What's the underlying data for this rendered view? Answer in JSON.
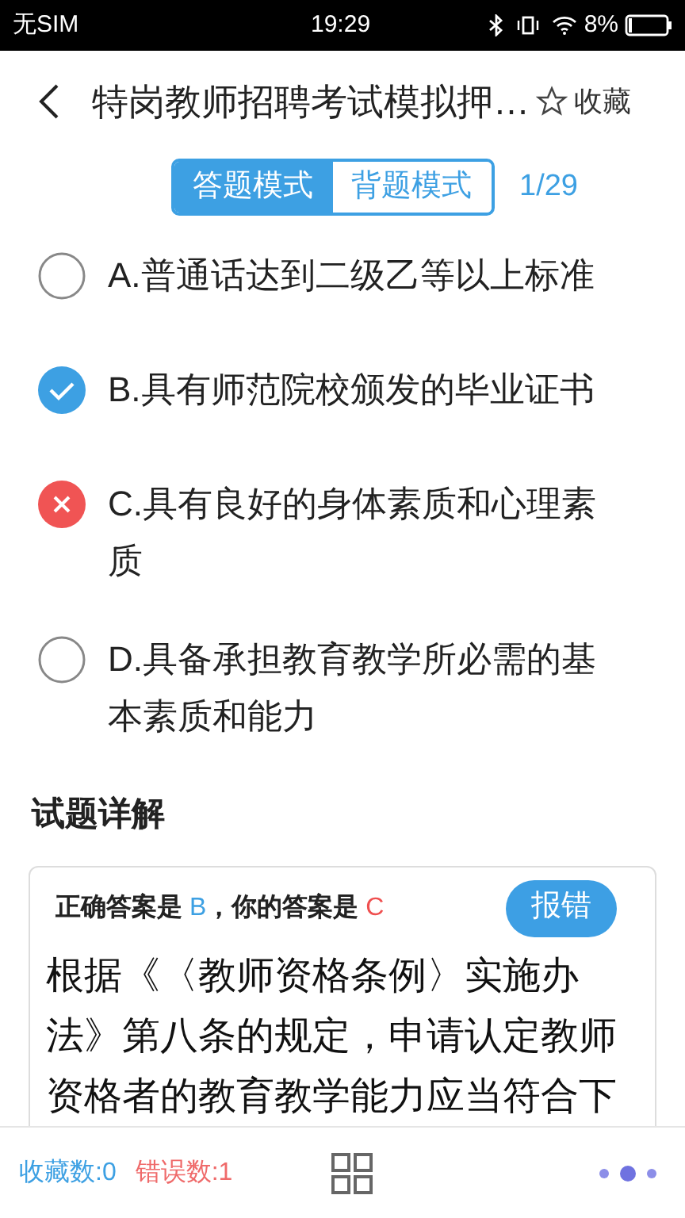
{
  "status_bar": {
    "carrier": "无SIM",
    "time": "19:29",
    "battery": "8%"
  },
  "header": {
    "title": "特岗教师招聘考试模拟押…",
    "favorite": "收藏"
  },
  "modes": [
    {
      "label": "答题模式",
      "selected": true
    },
    {
      "label": "背题模式",
      "selected": false
    }
  ],
  "progress": "1/29",
  "options": [
    {
      "text": "A.普通话达到二级乙等以上标准",
      "kind": "unmarked",
      "selected": false
    },
    {
      "text": "B.具有师范院校颁发的毕业证书",
      "kind": "correct",
      "selected": false
    },
    {
      "text": "C.具有良好的身体素质和心理素质",
      "kind": "wrong",
      "selected": true
    },
    {
      "text": "D.具备承担教育教学所必需的基本素质和能力",
      "kind": "unmarked",
      "selected": false
    }
  ],
  "explanation": {
    "heading": "试题详解",
    "correct_letter": "B",
    "your_letter": "C",
    "correct_label": "正确答案是",
    "your_label": "，你的答案是",
    "report_button": "报错",
    "text": "根据《〈教师资格条例〉实施办法》第八条的规定，申请认定教师资格者的教育教学能力应当符合下"
  },
  "bottom_bar": {
    "favorites": "收藏数:0",
    "errors": "错误数:1"
  }
}
